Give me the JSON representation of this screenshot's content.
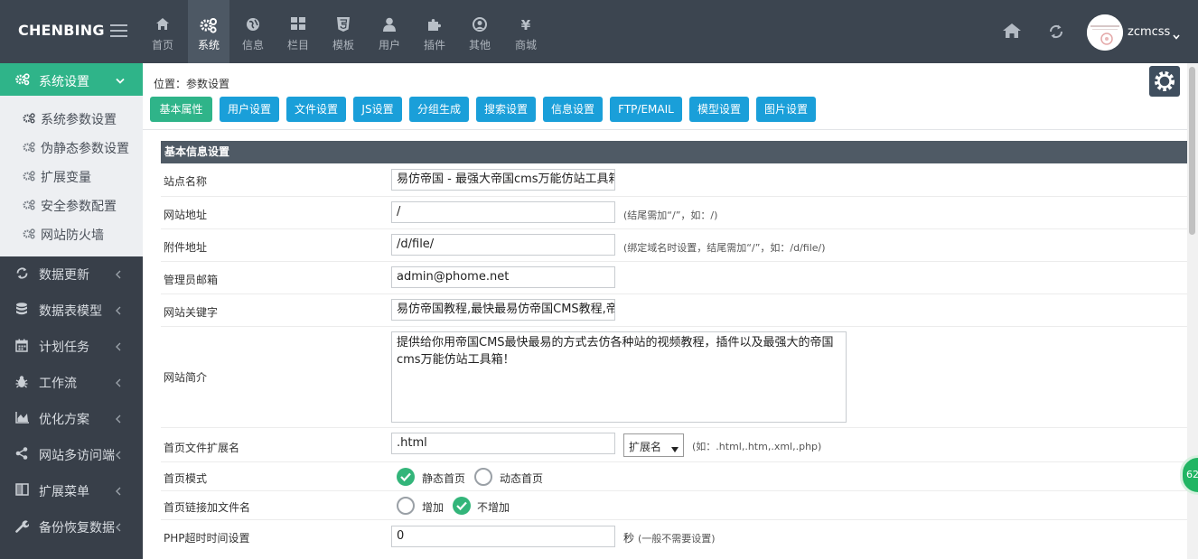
{
  "header": {
    "brand": "CHENBING",
    "nav": [
      {
        "label": "首页",
        "icon": "home-icon"
      },
      {
        "label": "系统",
        "icon": "cogs-icon",
        "active": true
      },
      {
        "label": "信息",
        "icon": "globe-icon"
      },
      {
        "label": "栏目",
        "icon": "grid-icon"
      },
      {
        "label": "模板",
        "icon": "html5-icon"
      },
      {
        "label": "用户",
        "icon": "user-icon"
      },
      {
        "label": "插件",
        "icon": "puzzle-icon"
      },
      {
        "label": "其他",
        "icon": "user-circle-icon"
      },
      {
        "label": "商城",
        "icon": "yen-icon"
      }
    ],
    "username": "zcmcss",
    "yen_glyph": "¥"
  },
  "sidebar": {
    "active_section": "系统设置",
    "sub_items": [
      "系统参数设置",
      "伪静态参数设置",
      "扩展变量",
      "安全参数配置",
      "网站防火墙"
    ],
    "sections": [
      "数据更新",
      "数据表模型",
      "计划任务",
      "工作流",
      "优化方案",
      "网站多访问端",
      "扩展菜单",
      "备份恢复数据"
    ]
  },
  "content": {
    "breadcrumb": "位置：参数设置",
    "tabs": [
      "基本属性",
      "用户设置",
      "文件设置",
      "JS设置",
      "分组生成",
      "搜索设置",
      "信息设置",
      "FTP/EMAIL",
      "模型设置",
      "图片设置"
    ],
    "active_tab": "基本属性",
    "section_title": "基本信息设置",
    "fields": {
      "site_name": {
        "label": "站点名称",
        "value": "易仿帝国 - 最强大帝国cms万能仿站工具箱"
      },
      "site_url": {
        "label": "网站地址",
        "value": "/",
        "hint": "(结尾需加“/”，如：/)"
      },
      "file_url": {
        "label": "附件地址",
        "value": "/d/file/",
        "hint": "(绑定域名时设置，结尾需加“/”，如：/d/file/)"
      },
      "admin_email": {
        "label": "管理员邮箱",
        "value": "admin@phome.net"
      },
      "keywords": {
        "label": "网站关键字",
        "value": "易仿帝国教程,最快最易仿帝国CMS教程,帝国"
      },
      "description": {
        "label": "网站简介",
        "value": "提供给你用帝国CMS最快最易的方式去仿各种站的视频教程，插件以及最强大的帝国cms万能仿站工具箱！"
      },
      "index_ext": {
        "label": "首页文件扩展名",
        "value": ".html",
        "select": "扩展名",
        "hint": "(如：.html,.htm,.xml,.php)"
      },
      "index_mode": {
        "label": "首页模式",
        "options": [
          "静态首页",
          "动态首页"
        ],
        "selected": "静态首页"
      },
      "index_link": {
        "label": "首页链接加文件名",
        "options": [
          "增加",
          "不增加"
        ],
        "selected": "不增加"
      },
      "php_timeout": {
        "label": "PHP超时时间设置",
        "value": "0",
        "unit": "秒",
        "hint": "(一般不需要设置)"
      }
    },
    "float_badge": "62"
  },
  "colors": {
    "header": "#3c4550",
    "sidebar": "#383f49",
    "accent_green": "#2fb489",
    "tab_blue": "#1a9fd9",
    "radio_green": "#33b57a"
  }
}
